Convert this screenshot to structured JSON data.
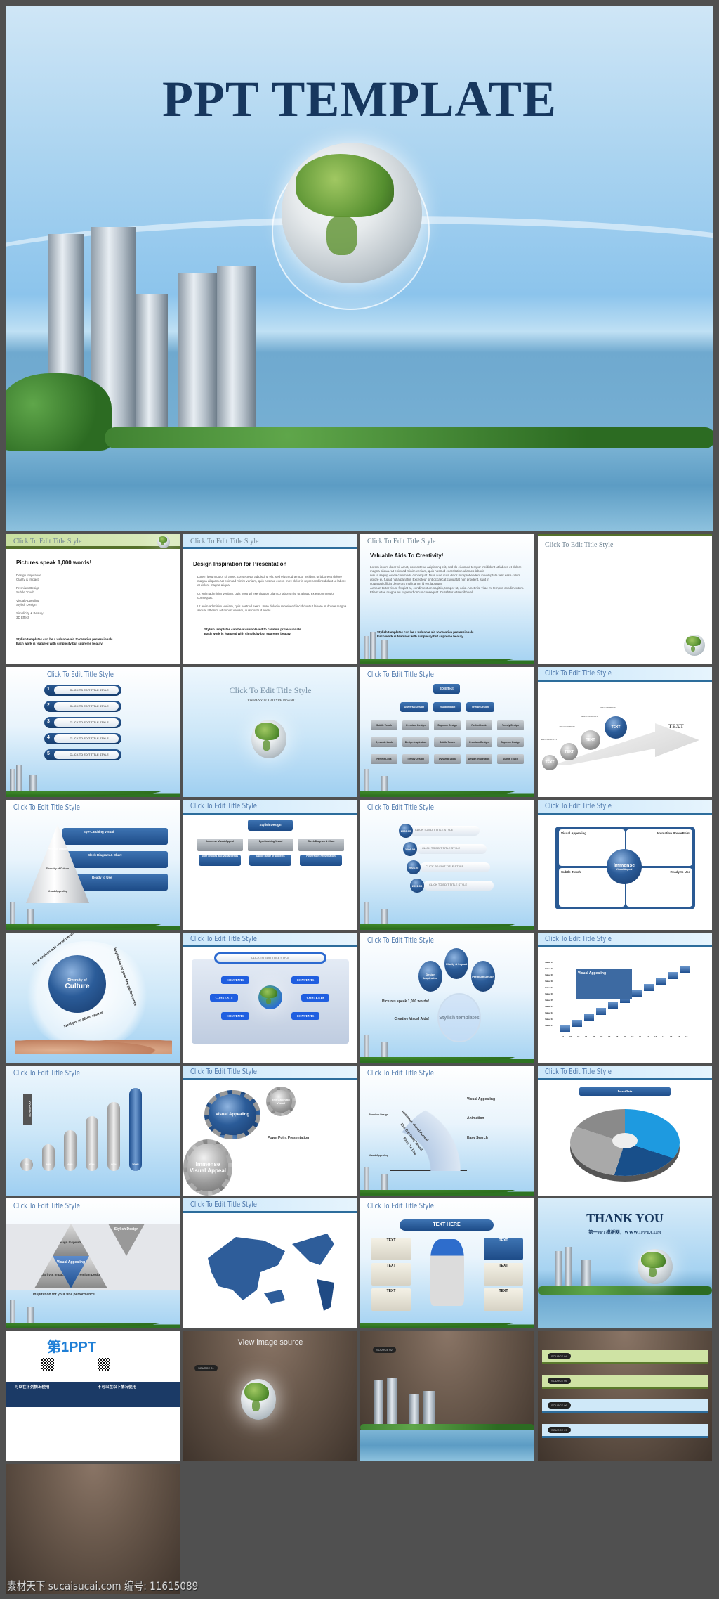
{
  "hero": {
    "title": "PPT TEMPLATE"
  },
  "common_title": "Click To Edit Title Style",
  "slides": [
    {
      "heading": "Pictures speak 1,000 words!",
      "bullets": [
        "Design Inspiration",
        "Clarity & Impact",
        "Premium Design",
        "Subtle Touch",
        "Visual Appealing",
        "Stylish Design",
        "Simplicity & Beauty",
        "3D Effect"
      ],
      "footer": [
        "Stylish templates can be a valuable aid to creative professionals.",
        "Each work is featured with simplicity but supreme beauty."
      ]
    },
    {
      "heading": "Design Inspiration for Presentation",
      "bullets": [
        "Lorem ipsum dolor sit amet, consectetur adipiscing elit, sed eiusmod tempor incidunt ut labore et dolore magna aliquam. Ut enim ad minim veniam, quis nostrud exerc. Irure dolor in reprehend incididunt ut labore et dolore magna aliqua.",
        "Ut enim ad minim veniam, quis nostrud exercitation ullamco laboris nisi ut aliquip ex ea commodo consequat.",
        "Ut enim ad minim veniam, quis nostrud exerc. Irure dolor in reprehend incididunt ut labore et dolore magna aliqua. Ut enim ad minim veniam, quis nostrud exerc."
      ],
      "footer": [
        "Stylish templates can be a valuable aid to creative professionals.",
        "Each work is featured with simplicity but supreme beauty."
      ]
    },
    {
      "heading": "Valuable Aids To Creativity!",
      "bullets": [
        "Lorem ipsum dolor sit amet, consectetur adipiscing elit, sed do eiusmod tempor incididunt ut labore et dolore magna aliqua. Ut enim ad minim veniam, quis nostrud exercitation ullamco laboris",
        "nisi ut aliquip ex ea commodo consequat. Duis aute irure dolor in reprehenderit in voluptate velit esse cillum dolore eu fugiat nulla pariatur. Excepteur sint occaecat cupidatat non proident, sunt in",
        "culpa qui officia deserunt mollit anim id est laborum.",
        "Aenean tortor risus, feugiat at, condimentum sagittis, tempor ut, odio. Amet nisi vitae mi tempus condimentum. Etiam vitae magna eu sapien rhoncus consequat. Curabitur vitae nibh vel"
      ],
      "footer": [
        "Stylish templates can be a valuable aid to creative professionals.",
        "Each work is featured with simplicity but supreme beauty."
      ]
    },
    {},
    {
      "numbers": [
        "1",
        "2",
        "3",
        "4",
        "5"
      ],
      "item": "CLICK TO EDIT TITLE STYLE"
    },
    {
      "subtitle": "COMPANY LOGOTYPE INSERT"
    },
    {
      "top": "3D Effect",
      "mid": [
        "Universal Design",
        "Visual Impact",
        "Stylish Design"
      ],
      "grid": [
        "Subtle Touch",
        "Premium Design",
        "Supreme Design",
        "Perfect Look",
        "Trendy Design",
        "Dynamic Look",
        "Design Inspiration",
        "Subtle Touch",
        "Premium Design",
        "Supreme Design",
        "Perfect Look",
        "Trendy Design",
        "Dynamic Look",
        "Design Inspiration",
        "Subtle Touch"
      ]
    },
    {
      "ball": "TEXT",
      "add": "ADD CONTENTS"
    },
    {
      "items": [
        "Eye-Catching Visual",
        "Sleek Diagram & Chart",
        "Ready to Use"
      ],
      "levels": [
        "Premium Design",
        "Diversity of Culture",
        "Visual Appealing"
      ]
    },
    {
      "top": "Stylish Design",
      "cols": [
        "Immense Visual Appeal",
        "Eye-Catching Visual",
        "Sleek Diagram & Chart"
      ],
      "subs": [
        "More choices and visual trends",
        "A wide range of subjects",
        "PowerPoint Presentation"
      ]
    },
    {
      "dates": [
        "2008.05",
        "2006.05",
        "2004.05",
        "2001.05"
      ],
      "item": "CLICK TO EDIT TITLE STYLE"
    },
    {
      "corners": [
        "Visual Appealing",
        "Animation PowerPoint",
        "Subtle Touch",
        "Ready to Use"
      ],
      "center": "Immense",
      "center_sub": "Visual Appeal"
    },
    {
      "center1": "Diversity of",
      "center2": "Culture",
      "arc1": "More choices and visual trends",
      "arc2": "Inspiration for your fine performance",
      "arc3": "A wide range of subjects"
    },
    {
      "header": "CLICK TO EDIT TITLE STYLE",
      "node": "CONTENTS"
    },
    {
      "balls": [
        "Design Inspiration",
        "Clarity & Impact",
        "Premium Design"
      ],
      "big": "Stylish templates",
      "left1": "Pictures speak 1,000 words!",
      "left2": "Creative Visual Aids!"
    },
    {
      "box": "Visual Appealing",
      "ylabels": [
        "Value 11",
        "Value 10",
        "Value 09",
        "Value 08",
        "Value 07",
        "Value 06",
        "Value 05",
        "Value 04",
        "Value 03",
        "Value 02",
        "Value 01"
      ],
      "xlabels": [
        "01",
        "02",
        "03",
        "04",
        "05",
        "06",
        "07",
        "08",
        "09",
        "10",
        "11",
        "12",
        "13",
        "14",
        "15",
        "16",
        "17"
      ]
    },
    {
      "arrow": "CONTENTS",
      "bars": [
        "0%",
        "20%",
        "40%",
        "60%",
        "80%",
        "100%"
      ],
      "levels": [
        0,
        0.2,
        0.4,
        0.6,
        0.8,
        1.0
      ]
    },
    {
      "gears": [
        "Visual Appealing",
        "Eye Catching Visual",
        "Immense Visual Appeal"
      ],
      "text": "PowerPoint Presentation"
    },
    {
      "arcs": [
        "Immense Visual Appeal",
        "Eye-Catching Visual",
        "Easy To Use"
      ],
      "right": [
        "Visual Appealing",
        "Animation",
        "Easy Search"
      ],
      "left": [
        "Premium Design",
        "Visual Appealing"
      ]
    },
    {
      "header": "InsertData"
    },
    {
      "tris": [
        "Stylish Design",
        "Design Inspiration",
        "Visual Appealing",
        "Clarity & Impact",
        "Premium Design"
      ],
      "caption": "Inspiration for your fine performance"
    },
    {},
    {
      "header": "TEXT HERE",
      "box": "TEXT"
    },
    {
      "title": "THANK YOU",
      "sub": "第一PPT模板网，WWW.1PPT.COM"
    },
    {
      "logo": "第1PPT",
      "can": "可以在下列情况使用",
      "cannot": "不可以在以下情况使用"
    },
    {
      "title": "View image source",
      "source": "SOURCE 01"
    },
    {
      "source": "SOURCE 02"
    },
    {
      "sources": [
        "SOURCE 04",
        "SOURCE 05",
        "SOURCE 06",
        "SOURCE 07"
      ]
    },
    {}
  ],
  "watermark": "素材天下 sucaisucai.com  编号: 11615089"
}
